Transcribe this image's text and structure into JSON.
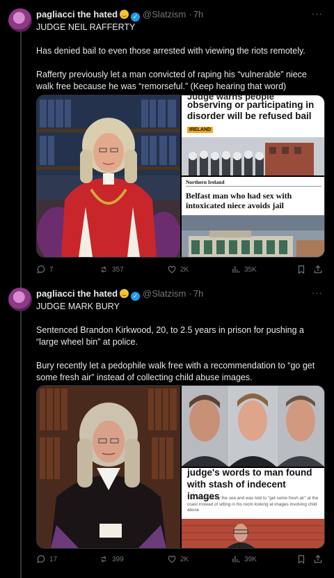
{
  "tweets": [
    {
      "author_name": "pagliacci the hated",
      "author_handle": "@Slatzism",
      "time": "7h",
      "more_glyph": "···",
      "text_lines": [
        "JUDGE NEIL RAFFERTY",
        "Has denied bail to even those arrested with viewing the riots remotely.",
        "Rafferty previously let a man convicted of raping his “vulnerable” niece walk free because he was “remorseful.” (Keep hearing that word)"
      ],
      "media": {
        "headline_1": "observing or participating in disorder will be refused bail",
        "headline_1_partial": "Judge warns people",
        "tag_1": "IRELAND",
        "section_2": "Northern Ireland",
        "headline_2": "Belfast man who had sex with intoxicated niece avoids jail"
      },
      "stats": {
        "replies": "7",
        "reposts": "357",
        "likes": "2K",
        "views": "35K"
      }
    },
    {
      "author_name": "pagliacci the hated",
      "author_handle": "@Slatzism",
      "time": "7h",
      "more_glyph": "···",
      "text_lines": [
        "JUDGE MARK BURY",
        "Sentenced Brandon Kirkwood, 20, to 2.5 years in prison for pushing a “large wheel bin” at police.",
        "Bury recently let a pedophile walk free with a recommendation to “go get some fresh air” instead of collecting child abuse images."
      ],
      "media": {
        "headline_1": "judge's words to man found with stash of indecent images",
        "subtext_1": "The man lives by the sea and was told to \"get some fresh air\" at the coast instead of sitting in his room looking at images involving child abuse"
      },
      "stats": {
        "replies": "17",
        "reposts": "399",
        "likes": "2K",
        "views": "39K"
      }
    }
  ],
  "colors": {
    "background": "#000000",
    "text": "#e7e9ea",
    "muted": "#71767b",
    "verified": "#1d9bf0",
    "divider": "#2f3336"
  }
}
